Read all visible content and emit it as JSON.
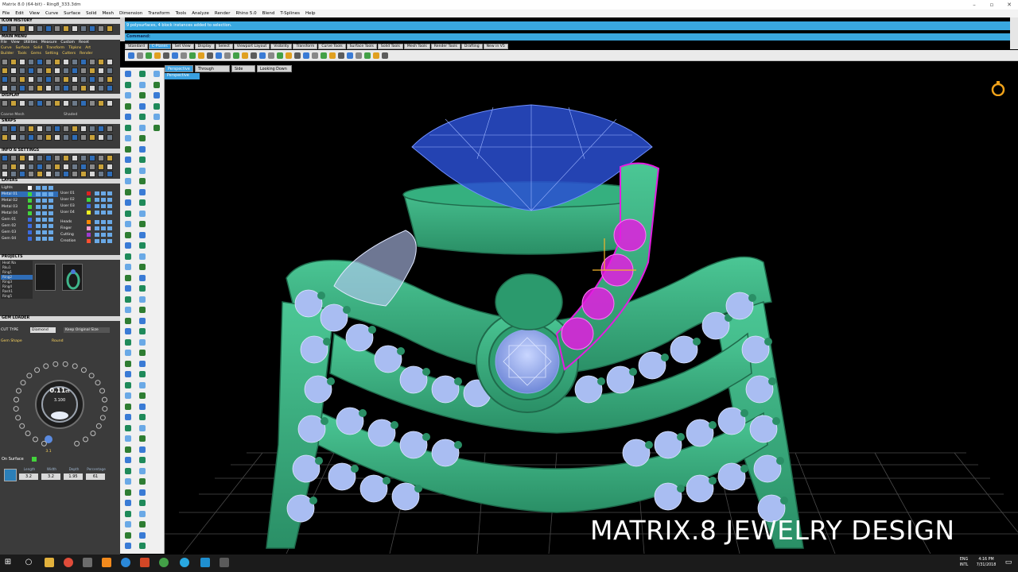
{
  "window": {
    "title": "Matrix 8.0 (64-bit) - Ring8_333.3dm"
  },
  "menu": [
    "File",
    "Edit",
    "View",
    "Curve",
    "Surface",
    "Solid",
    "Mesh",
    "Dimension",
    "Transform",
    "Tools",
    "Analyze",
    "Render",
    "Rhino 5.0",
    "Blend",
    "T-Splines",
    "Help"
  ],
  "status_message": "9 polysurfaces, 4 block instances added to selection.",
  "command_label": "Command:",
  "toolbar_tabs": [
    "Standard",
    "C-Planes",
    "Set View",
    "Display",
    "Select",
    "Viewport Layout",
    "Visibility",
    "Transform",
    "Curve Tools",
    "Surface Tools",
    "Solid Tools",
    "Mesh Tools",
    "Render Tools",
    "Drafting",
    "New in V5"
  ],
  "toolbar_active_tab": "C-Planes",
  "viewport_tabs": [
    "Perspective",
    "Through Finger",
    "Side View",
    "Looking Down"
  ],
  "viewport_label": "Perspective",
  "left_panel": {
    "icon_history": "ICON HISTORY",
    "main_menu": "MAIN MENU",
    "main_menu_items": [
      "File",
      "View",
      "Utilities",
      "Measure",
      "Custom",
      "Reset"
    ],
    "main_menu_row2": [
      "Curve",
      "Surface",
      "Solid",
      "Transform",
      "Tilpkns",
      "Art"
    ],
    "main_menu_row3": [
      "Builder",
      "Tools",
      "Gems",
      "Setting",
      "Cutters",
      "Render"
    ],
    "display": "DISPLAY",
    "display_modes": [
      "Coarse Mesh",
      "Shaded"
    ],
    "snaps": "SNAPS",
    "info_settings": "INFO & SETTINGS",
    "layers": "LAYERS",
    "layers_left": [
      "Lights",
      "Metal 01",
      "Metal 02",
      "Metal 03",
      "Metal 04",
      "Gem 01",
      "Gem 02",
      "Gem 03",
      "Gem 04"
    ],
    "layers_right": [
      "User 01",
      "User 02",
      "User 03",
      "User 04",
      "Heads",
      "Finger",
      "Cutting",
      "Creation"
    ],
    "projects": "PROJECTS",
    "project_items": [
      "Heat Na",
      "Rku1",
      "Ring1",
      "Ring2",
      "Ring3",
      "Ring4",
      "Rash1",
      "Ring5"
    ],
    "gem_loader": "GEM LOADER",
    "cut_type_label": "CUT TYPE",
    "cut_type": "Diamond",
    "keep_original_size": "Keep Original Size",
    "gem_shape_label": "Gem Shape",
    "gem_shape": "Round",
    "carat": "0.11",
    "carat_unit": "ct",
    "diameter": "3.100",
    "dial_bottom": "3.1",
    "on_surface": "On Surface",
    "dims_labels": [
      "Length",
      "Width",
      "Depth",
      "Percentage"
    ],
    "dims_values": [
      "3.2",
      "3.2",
      "1.95",
      "61"
    ]
  },
  "watermark": "MATRIX.8 JEWELRY DESIGN",
  "taskbar": {
    "lang_top": "ENG",
    "lang_bottom": "INTL",
    "time": "4:16 PM",
    "date": "7/31/2018"
  },
  "colors": {
    "accent": "#39a8e0",
    "metal": "#3fb58a",
    "gem_center": "#2a4fd1",
    "gem_selected": "#e31de0"
  }
}
